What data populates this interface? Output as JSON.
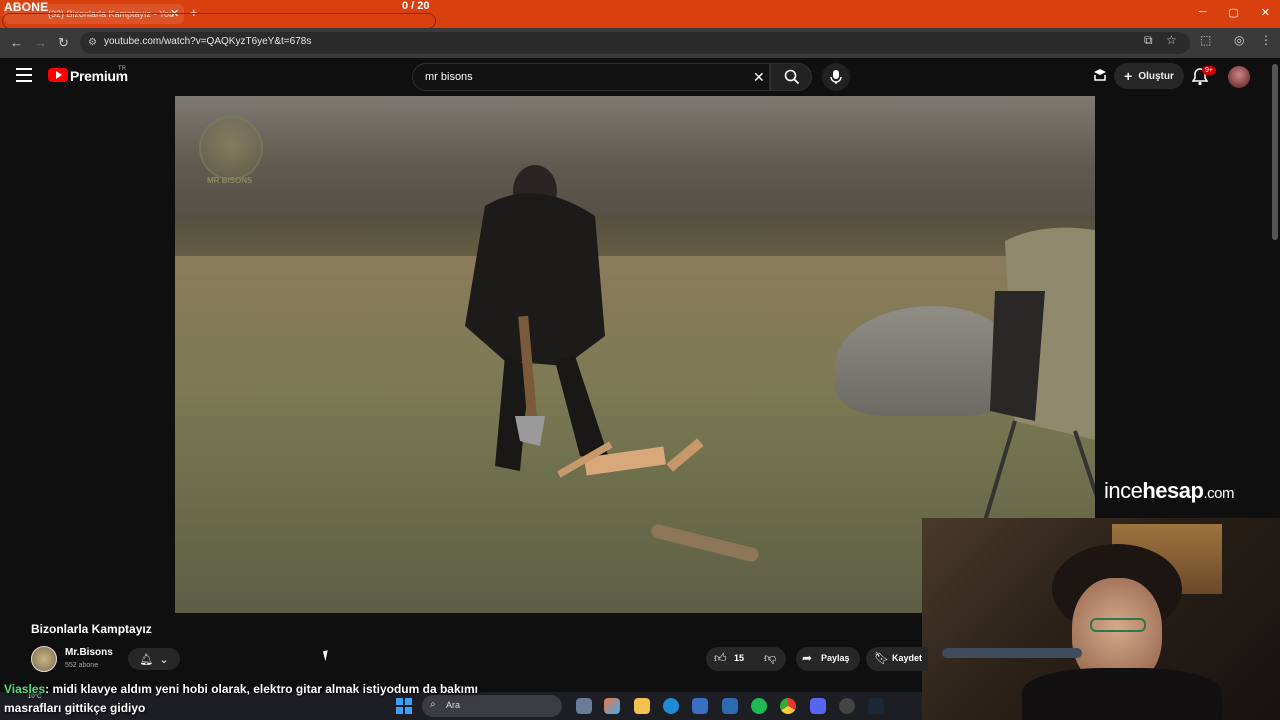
{
  "overlay": {
    "abone_label": "ABONE",
    "goal_progress_text": "0  / 20",
    "goal_progress_value": 0,
    "goal_progress_max": 20
  },
  "browser": {
    "tab_title": "(32) Bizonlarla Kamptayız - You",
    "url": "youtube.com/watch?v=QAQKyzT6yeY&t=678s"
  },
  "youtube": {
    "brand": "Premium",
    "region": "TR",
    "search_value": "mr bisons",
    "create_label": "Oluştur",
    "notif_badge": "9+"
  },
  "video": {
    "title": "Bizonlarla Kamptayız",
    "watermark_text": "MR BISONS",
    "channel_name": "Mr.Bisons",
    "channel_subs": "552 abone",
    "like_count": "15",
    "share_label": "Paylaş",
    "save_label": "Kaydet"
  },
  "sponsor": {
    "brand_a": "ince",
    "brand_b": "hesap",
    "brand_c": ".com"
  },
  "chat": {
    "username": "Viasles",
    "message": ": midi klavye aldım yeni hobi olarak, elektro gitar almak istiyodum da bakımı masrafları gittikçe gidiyo"
  },
  "taskbar": {
    "weather": "10°C",
    "search_label": "Ara"
  },
  "colors": {
    "chrome_accent": "#d9400f",
    "yt_red": "#ff0000",
    "chat_user": "#4ee07a"
  }
}
